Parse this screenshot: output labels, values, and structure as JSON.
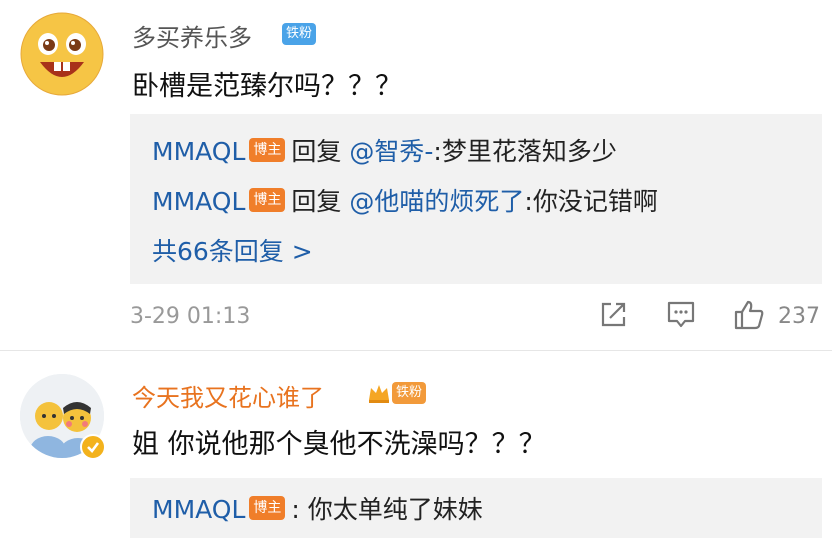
{
  "comments": [
    {
      "username": "多买养乐多",
      "badge": "铁粉",
      "text": "卧槽是范臻尔吗？？？",
      "replies": [
        {
          "user": "MMAQL",
          "host_badge": "博主",
          "action": "回复",
          "mention": "@智秀-",
          "text": ":梦里花落知多少"
        },
        {
          "user": "MMAQL",
          "host_badge": "博主",
          "action": "回复",
          "mention": "@他喵的烦死了",
          "text": ":你没记错啊"
        }
      ],
      "more_replies": "共66条回复 >",
      "timestamp": "3-29 01:13",
      "likes": "237"
    },
    {
      "username": "今天我又花心谁了",
      "badge": "铁粉",
      "text": "姐 你说他那个臭他不洗澡吗？？？",
      "replies": [
        {
          "user": "MMAQL",
          "host_badge": "博主",
          "text": ": 你太单纯了妹妹"
        }
      ]
    }
  ],
  "colors": {
    "link_blue": "#1f5ea8",
    "orange_name": "#e8731f",
    "host_badge": "#f07e2a",
    "fan_badge_blue": "#4aa3e8",
    "fan_badge_orange": "#f29a3a",
    "reply_bg": "#f2f2f2"
  },
  "icons": [
    "share-icon",
    "comment-icon",
    "like-icon",
    "verified-icon",
    "crown-icon"
  ]
}
